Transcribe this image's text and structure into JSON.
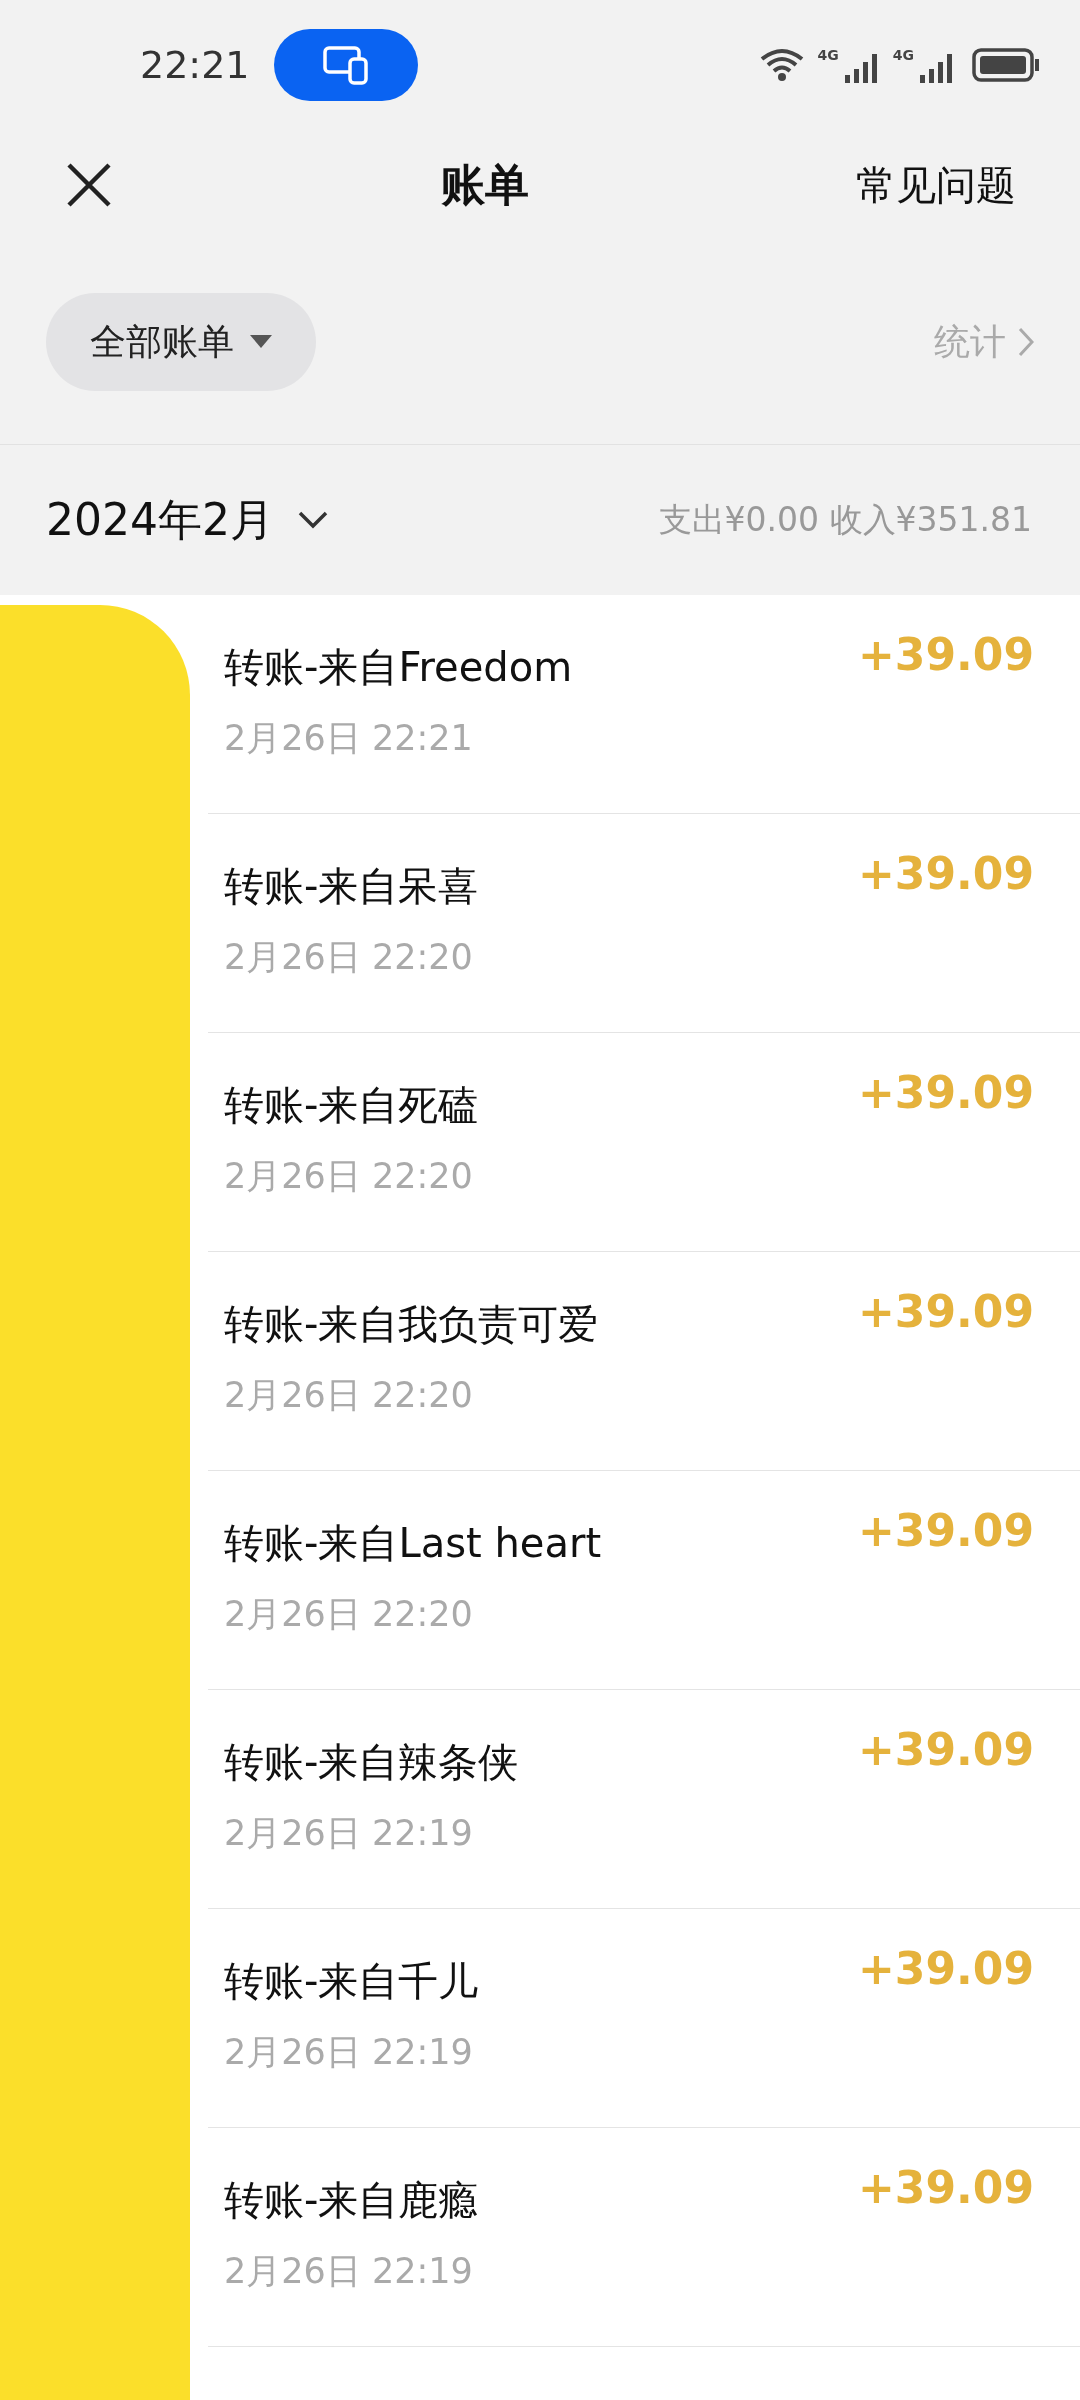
{
  "status_bar": {
    "time": "22:21",
    "networks": [
      "4G",
      "4G"
    ]
  },
  "nav": {
    "title": "账单",
    "action": "常见问题"
  },
  "filter": {
    "label": "全部账单",
    "stats": "统计"
  },
  "month": {
    "label": "2024年2月",
    "summary": "支出¥0.00 收入¥351.81"
  },
  "transactions": [
    {
      "title": "转账-来自Freedom",
      "time": "2月26日 22:21",
      "amount": "+39.09"
    },
    {
      "title": "转账-来自呆喜",
      "time": "2月26日 22:20",
      "amount": "+39.09"
    },
    {
      "title": "转账-来自死磕",
      "time": "2月26日 22:20",
      "amount": "+39.09"
    },
    {
      "title": "转账-来自我负责可爱",
      "time": "2月26日 22:20",
      "amount": "+39.09"
    },
    {
      "title": "转账-来自Last heart",
      "time": "2月26日 22:20",
      "amount": "+39.09"
    },
    {
      "title": "转账-来自辣条侠",
      "time": "2月26日 22:19",
      "amount": "+39.09"
    },
    {
      "title": "转账-来自千儿",
      "time": "2月26日 22:19",
      "amount": "+39.09"
    },
    {
      "title": "转账-来自鹿瘾",
      "time": "2月26日 22:19",
      "amount": "+39.09"
    }
  ]
}
